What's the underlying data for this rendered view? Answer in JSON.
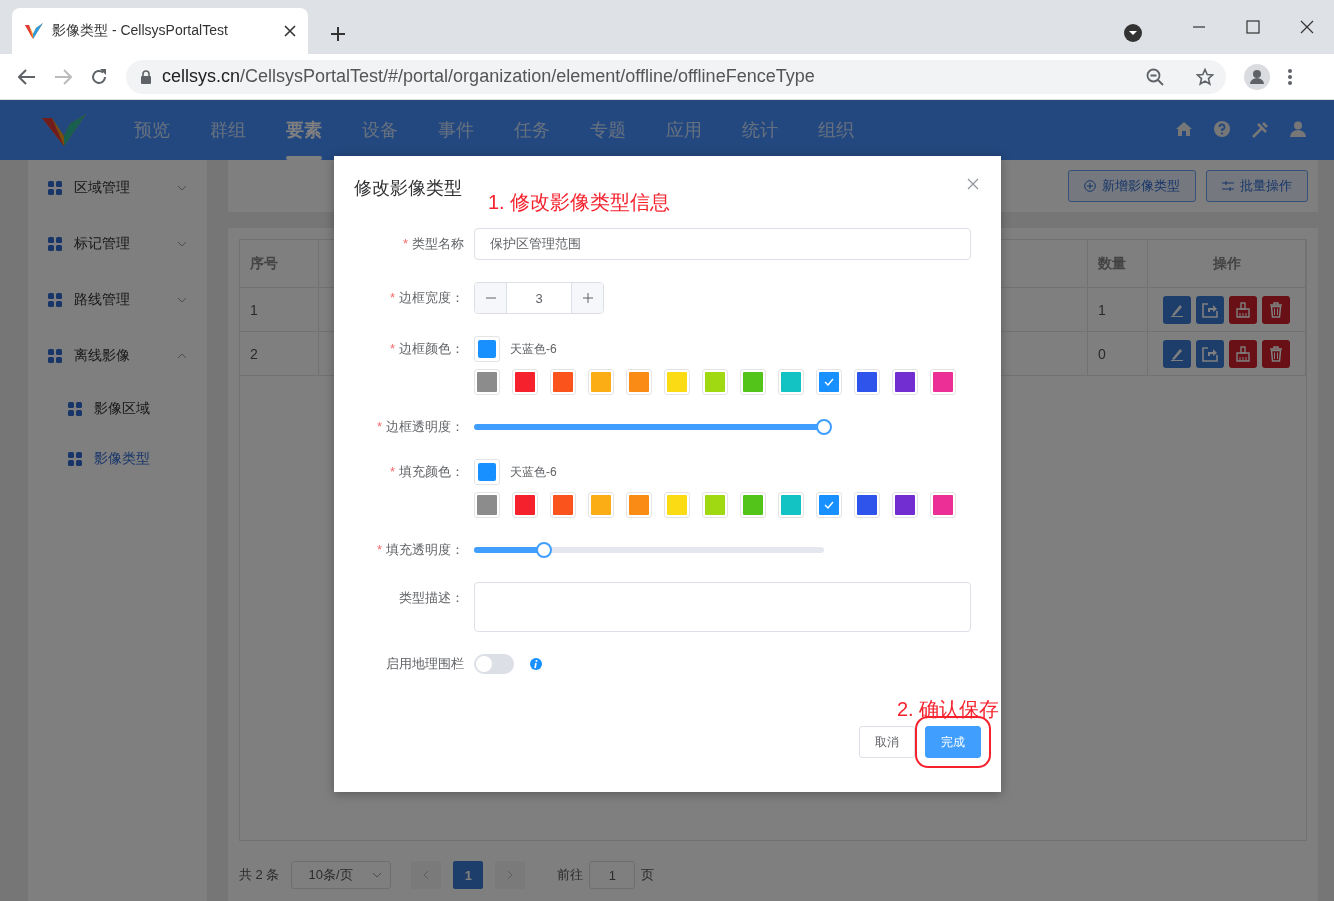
{
  "browser": {
    "tab_title": "影像类型 - CellsysPortalTest",
    "url_host": "cellsys.cn",
    "url_path": "/CellsysPortalTest/#/portal/organization/element/offline/offlineFenceType"
  },
  "nav": {
    "items": [
      {
        "label": "预览",
        "selected": false
      },
      {
        "label": "群组",
        "selected": false
      },
      {
        "label": "要素",
        "selected": true
      },
      {
        "label": "设备",
        "selected": false
      },
      {
        "label": "事件",
        "selected": false
      },
      {
        "label": "任务",
        "selected": false
      },
      {
        "label": "专题",
        "selected": false
      },
      {
        "label": "应用",
        "selected": false
      },
      {
        "label": "统计",
        "selected": false
      },
      {
        "label": "组织",
        "selected": false
      }
    ]
  },
  "sidebar": {
    "items": [
      {
        "label": "区域管理",
        "expanded": false,
        "selected": false
      },
      {
        "label": "标记管理",
        "expanded": false,
        "selected": false
      },
      {
        "label": "路线管理",
        "expanded": false,
        "selected": false
      },
      {
        "label": "离线影像",
        "expanded": true,
        "selected": false,
        "children": [
          {
            "label": "影像区域",
            "selected": false
          },
          {
            "label": "影像类型",
            "selected": true
          }
        ]
      }
    ]
  },
  "toolbar": {
    "buttons": [
      {
        "label": "新增影像类型",
        "kind": "add"
      },
      {
        "label": "批量操作",
        "kind": "batch"
      }
    ]
  },
  "table": {
    "columns": [
      "序号",
      "数量",
      "操作"
    ],
    "rows": [
      {
        "index": "1",
        "count": "1"
      },
      {
        "index": "2",
        "count": "0"
      }
    ]
  },
  "pagination": {
    "total": "共 2 条",
    "page_size": "10条/页",
    "pages": [
      {
        "label": "1",
        "selected": true
      }
    ],
    "goto_label": "前往",
    "goto_value": "1",
    "goto_suffix": "页"
  },
  "dialog": {
    "title": "修改影像类型",
    "fields": [
      {
        "kind": "text",
        "label": "类型名称",
        "required_mark": "*",
        "value": "保护区管理范围"
      },
      {
        "kind": "number",
        "label": "边框宽度：",
        "required_mark": "*",
        "value": "3"
      },
      {
        "kind": "color",
        "label": "边框颜色：",
        "required_mark": "*",
        "current": {
          "color": "#1890ff",
          "name": "天蓝色-6"
        },
        "swatches": [
          {
            "color": "#8c8c8c",
            "selected": false
          },
          {
            "color": "#f5222d",
            "selected": false
          },
          {
            "color": "#fa541c",
            "selected": false
          },
          {
            "color": "#faad14",
            "selected": false
          },
          {
            "color": "#fa8c16",
            "selected": false
          },
          {
            "color": "#fadb14",
            "selected": false
          },
          {
            "color": "#a0d911",
            "selected": false
          },
          {
            "color": "#52c41a",
            "selected": false
          },
          {
            "color": "#13c2c2",
            "selected": false
          },
          {
            "color": "#1890ff",
            "selected": true
          },
          {
            "color": "#2f54eb",
            "selected": false
          },
          {
            "color": "#722ed1",
            "selected": false
          },
          {
            "color": "#eb2f96",
            "selected": false
          }
        ]
      },
      {
        "kind": "slider",
        "label": "边框透明度：",
        "required_mark": "*",
        "level": 1
      },
      {
        "kind": "color",
        "label": "填充颜色：",
        "required_mark": "*",
        "current": {
          "color": "#1890ff",
          "name": "天蓝色-6"
        },
        "swatches": [
          {
            "color": "#8c8c8c",
            "selected": false
          },
          {
            "color": "#f5222d",
            "selected": false
          },
          {
            "color": "#fa541c",
            "selected": false
          },
          {
            "color": "#faad14",
            "selected": false
          },
          {
            "color": "#fa8c16",
            "selected": false
          },
          {
            "color": "#fadb14",
            "selected": false
          },
          {
            "color": "#a0d911",
            "selected": false
          },
          {
            "color": "#52c41a",
            "selected": false
          },
          {
            "color": "#13c2c2",
            "selected": false
          },
          {
            "color": "#1890ff",
            "selected": true
          },
          {
            "color": "#2f54eb",
            "selected": false
          },
          {
            "color": "#722ed1",
            "selected": false
          },
          {
            "color": "#eb2f96",
            "selected": false
          }
        ]
      },
      {
        "kind": "slider",
        "label": "填充透明度：",
        "required_mark": "*",
        "level": 0.2
      },
      {
        "kind": "textarea",
        "label": "类型描述："
      },
      {
        "kind": "switch",
        "label": "启用地理围栏",
        "on": false,
        "info": true
      }
    ],
    "buttons": [
      {
        "label": "取消",
        "kind": "default",
        "highlighted": false
      },
      {
        "label": "完成",
        "kind": "primary",
        "highlighted": true
      }
    ]
  },
  "annotations": {
    "step_note": "1. 修改影像类型信息",
    "confirm_note": "2. 确认保存"
  }
}
